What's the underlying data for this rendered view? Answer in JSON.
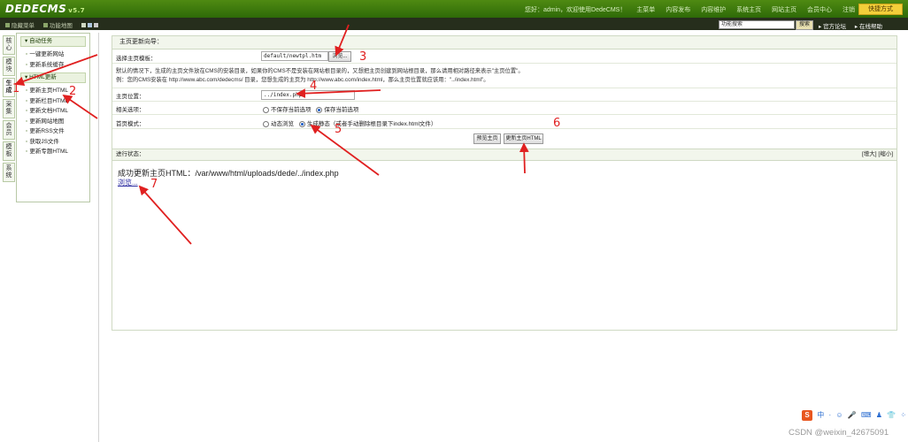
{
  "header": {
    "logo": "DEDECMS",
    "version": "v5.7",
    "greeting": "您好：admin，欢迎使用DedeCMS！",
    "nav": [
      "主菜单",
      "内容发布",
      "内容维护",
      "系统主页",
      "网站主页",
      "会员中心",
      "注销"
    ],
    "quick_button": "快捷方式"
  },
  "subbar": {
    "links": [
      "隐藏菜单",
      "功能地图"
    ],
    "search_value": "功能搜索",
    "search_button": "搜索",
    "right_links": [
      "官方论坛",
      "在线帮助"
    ]
  },
  "left_tabs": [
    "核心",
    "模块",
    "生成",
    "采集",
    "会员",
    "模板",
    "系统"
  ],
  "sidebar": {
    "group1_title": "自动任务",
    "group1_items": [
      "一键更新网站",
      "更新系统缓存"
    ],
    "group2_title": "HTML更新",
    "group2_items": [
      "更新主页HTML",
      "更新栏目HTML",
      "更新文档HTML",
      "更新网站地图",
      "更新RSS文件",
      "获取JS文件",
      "更新专题HTML"
    ]
  },
  "main": {
    "title": "主页更新向导：",
    "template_label": "选择主页模板：",
    "template_value": "default/newtpl.htm",
    "browse_button": "浏览...",
    "desc1": "默认的情况下，生成的主页文件放在CMS的安装目录，如果你的CMS不是安装在网站根目录的，又想把主页创建到网站根目录，那么请用相对路径来表示\"主页位置\"。",
    "desc2": "例：您的CMS安装在 http://www.abc.com/dedecms/ 目录，您想生成的主页为 http://www.abc.com/index.html，那么主页位置就应该用：\"../index.html\"。",
    "position_label": "主页位置：",
    "position_value": "../index.php",
    "related_label": "相关选项：",
    "related_opt1": "不保存当前选项",
    "related_opt2": "保存当前选项",
    "mode_label": "首页模式：",
    "mode_opt1": "动态浏览",
    "mode_opt2": "生成静态（或者手动删除根目录下index.html文件）",
    "preview_button": "预览主页",
    "update_button": "更新主页HTML",
    "status_label": "进行状态：",
    "status_controls": "[增大] [缩小]",
    "result_message": "成功更新主页HTML：/var/www/html/uploads/dede/../index.php",
    "result_link": "浏览..."
  },
  "annotations": [
    "1",
    "2",
    "3",
    "4",
    "5",
    "6",
    "7"
  ],
  "footer": {
    "tray_items": [
      "中",
      "·",
      "☺",
      "🎤",
      "⌨",
      "♟",
      "👕",
      "⁘"
    ],
    "watermark": "CSDN @weixin_42675091"
  },
  "colors": {
    "header_green": "#3c7a0d",
    "annotation_red": "#e02020",
    "quick_button": "#f3cf3a"
  }
}
